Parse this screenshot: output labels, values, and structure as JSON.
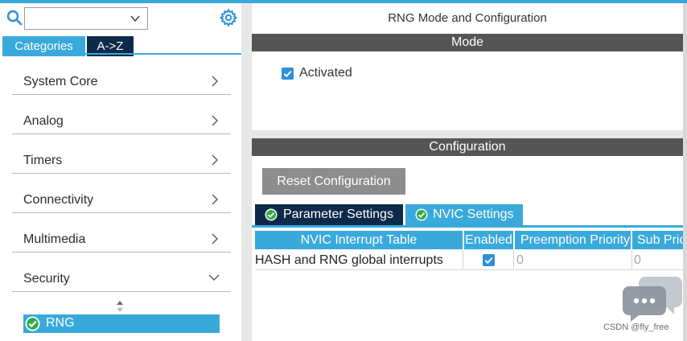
{
  "left_panel": {
    "search": {
      "value": "",
      "placeholder": ""
    },
    "tabs": {
      "categories": "Categories",
      "a_to_z": "A->Z"
    },
    "categories": [
      {
        "label": "System Core",
        "expanded": false
      },
      {
        "label": "Analog",
        "expanded": false
      },
      {
        "label": "Timers",
        "expanded": false
      },
      {
        "label": "Connectivity",
        "expanded": false
      },
      {
        "label": "Multimedia",
        "expanded": false
      },
      {
        "label": "Security",
        "expanded": true
      }
    ],
    "selected_item": {
      "label": "RNG",
      "status": "configured"
    }
  },
  "right_panel": {
    "title": "RNG Mode and Configuration",
    "mode": {
      "header": "Mode",
      "activated_label": "Activated",
      "activated": true
    },
    "configuration": {
      "header": "Configuration",
      "reset_button": "Reset Configuration",
      "tabs": [
        {
          "label": "Parameter Settings",
          "active": false
        },
        {
          "label": "NVIC Settings",
          "active": true
        }
      ],
      "nvic_table": {
        "columns": [
          "NVIC Interrupt Table",
          "Enabled",
          "Preemption Priority",
          "Sub Priority"
        ],
        "rows": [
          {
            "name": "HASH and RNG global interrupts",
            "enabled": true,
            "preemption": "0",
            "sub": "0"
          }
        ]
      }
    }
  },
  "watermark": {
    "text": "CSDN @fly_free"
  },
  "colors": {
    "accent": "#39a9dc",
    "dark_tab": "#0e2a4a",
    "section_bar": "#555555",
    "button": "#8d8d8d"
  }
}
